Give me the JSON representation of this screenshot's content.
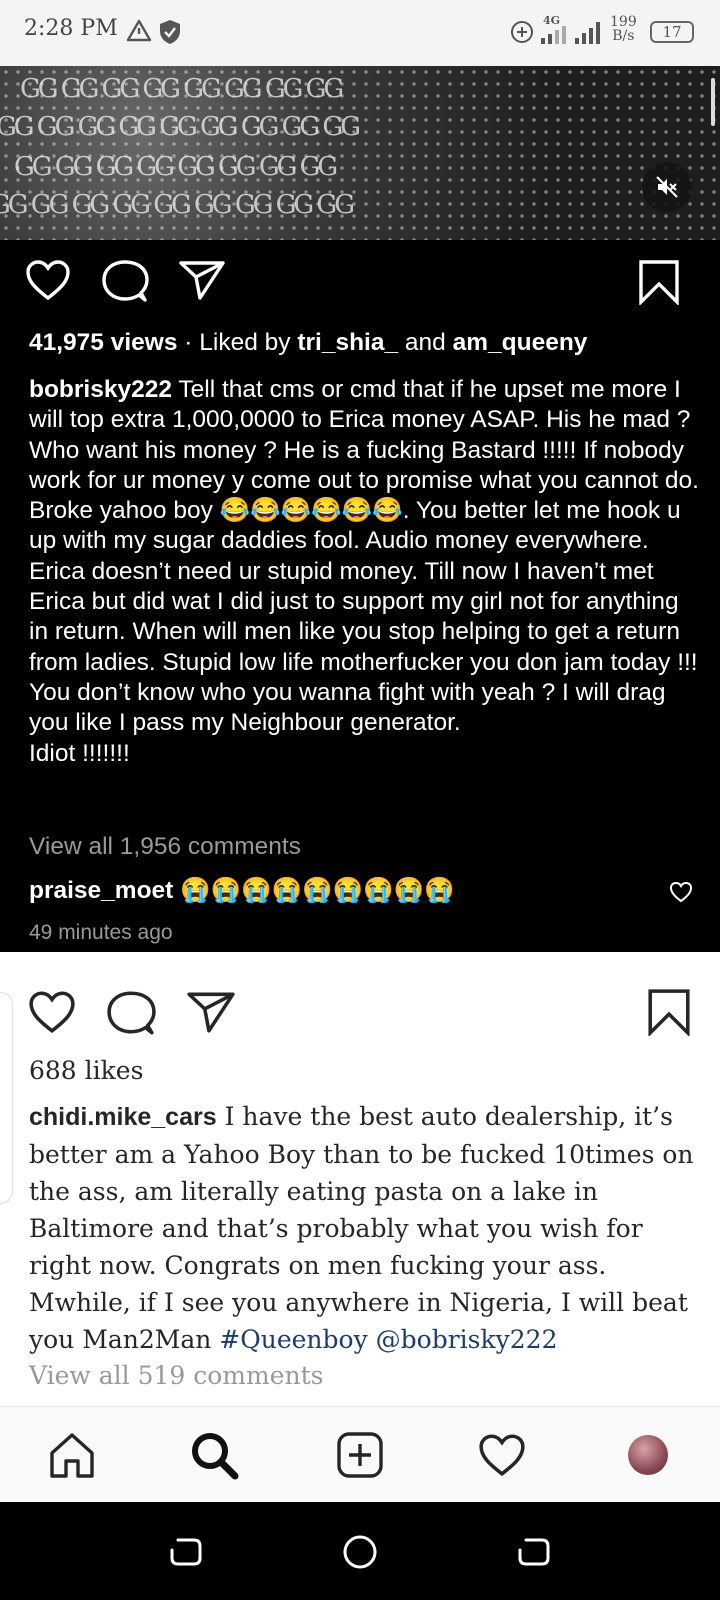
{
  "status_bar": {
    "time": "2:28 PM",
    "network": "4G",
    "speed_value": "199",
    "speed_unit": "B/s",
    "battery": "17"
  },
  "post1": {
    "views": "41,975 views",
    "liked_by_prefix": "· Liked by",
    "liked_user1": "tri_shia_",
    "liked_and": "and",
    "liked_user2": "am_queeny",
    "caption_user": "bobrisky222",
    "caption_part1": "Tell that cms or cmd that if he upset me more I will top extra 1,000,0000 to Erica money ASAP. His he mad ? Who want his money ? He is a fucking Bastard !!!!! If nobody work for ur money y come out to promise what you cannot do. Broke yahoo boy",
    "caption_emojis": "😂😂😂😂😂😂",
    "caption_part2": ". You better let me hook u up with my sugar daddies fool.  Audio money everywhere. Erica doesn’t need ur stupid money. Till now I haven’t met Erica but did wat I did just to support my girl not for anything in return. When will men like you stop helping to get a return from ladies. Stupid low life motherfucker you don jam today !!! You don’t know who you wanna fight with yeah ? I will drag you like I pass my Neighbour generator.",
    "caption_part3": "Idiot !!!!!!!",
    "view_all_comments": "View all 1,956 comments",
    "comment_user": "praise_moet",
    "comment_text": "😭😭😭😭😭😭😭😭😭",
    "time_ago": "49 minutes ago"
  },
  "post2": {
    "likes": "688 likes",
    "caption_user": "chidi.mike_cars",
    "caption_text": "I have the best auto dealership, it’s better am a Yahoo Boy than to be fucked 10times on the ass, am literally eating pasta on a lake in Baltimore and that’s probably what you wish for right now. Congrats on men fucking your ass. Mwhile, if I see you anywhere in Nigeria, I will beat you Man2Man",
    "hashtag": "#Queenboy",
    "mention": "@bobrisky222",
    "view_all_comments": "View all 519 comments"
  },
  "icons": [
    "warning-icon",
    "shield-icon",
    "data-saver-icon",
    "signal-icon",
    "battery-icon",
    "mute-icon",
    "heart-icon",
    "comment-icon",
    "share-icon",
    "bookmark-icon",
    "home-icon",
    "search-icon",
    "add-post-icon",
    "activity-icon",
    "profile-avatar",
    "back-icon",
    "home-circle-icon",
    "recents-icon"
  ],
  "colors": {
    "dark_bg": "#000000",
    "link": "#1d3c6e",
    "muted": "#9a9a9a"
  }
}
